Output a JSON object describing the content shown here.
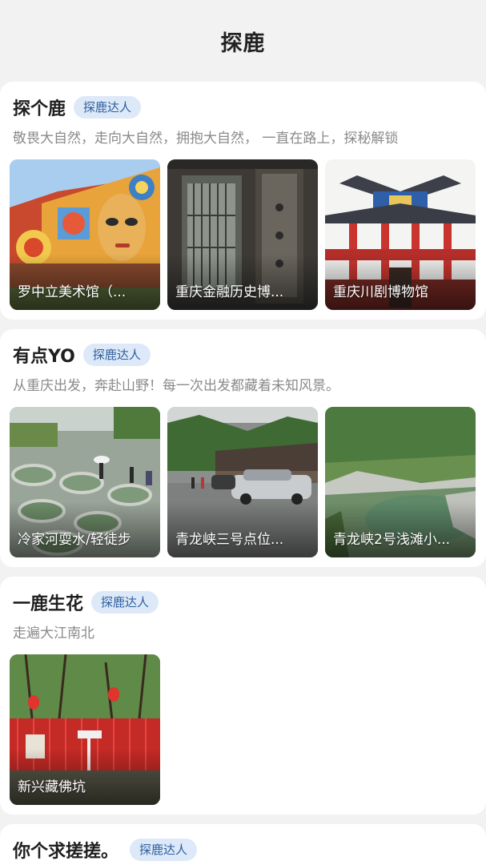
{
  "header": {
    "title": "探鹿"
  },
  "sections": [
    {
      "title": "探个鹿",
      "badge": "探鹿达人",
      "subtitle": "敬畏大自然，走向大自然，拥抱大自然， 一直在路上，探秘解锁",
      "items": [
        {
          "label": "罗中立美术馆（..."
        },
        {
          "label": "重庆金融历史博..."
        },
        {
          "label": "重庆川剧博物馆"
        }
      ]
    },
    {
      "title": "有点YO",
      "badge": "探鹿达人",
      "subtitle": "从重庆出发，奔赴山野！每一次出发都藏着未知风景。",
      "items": [
        {
          "label": "冷家河耍水/轻徒步"
        },
        {
          "label": "青龙峡三号点位..."
        },
        {
          "label": "青龙峡2号浅滩小..."
        }
      ]
    },
    {
      "title": "一鹿生花",
      "badge": "探鹿达人",
      "subtitle": "走遍大江南北",
      "items": [
        {
          "label": "新兴藏佛坑"
        }
      ]
    },
    {
      "title": "你个求搓搓。",
      "badge": "探鹿达人"
    }
  ]
}
